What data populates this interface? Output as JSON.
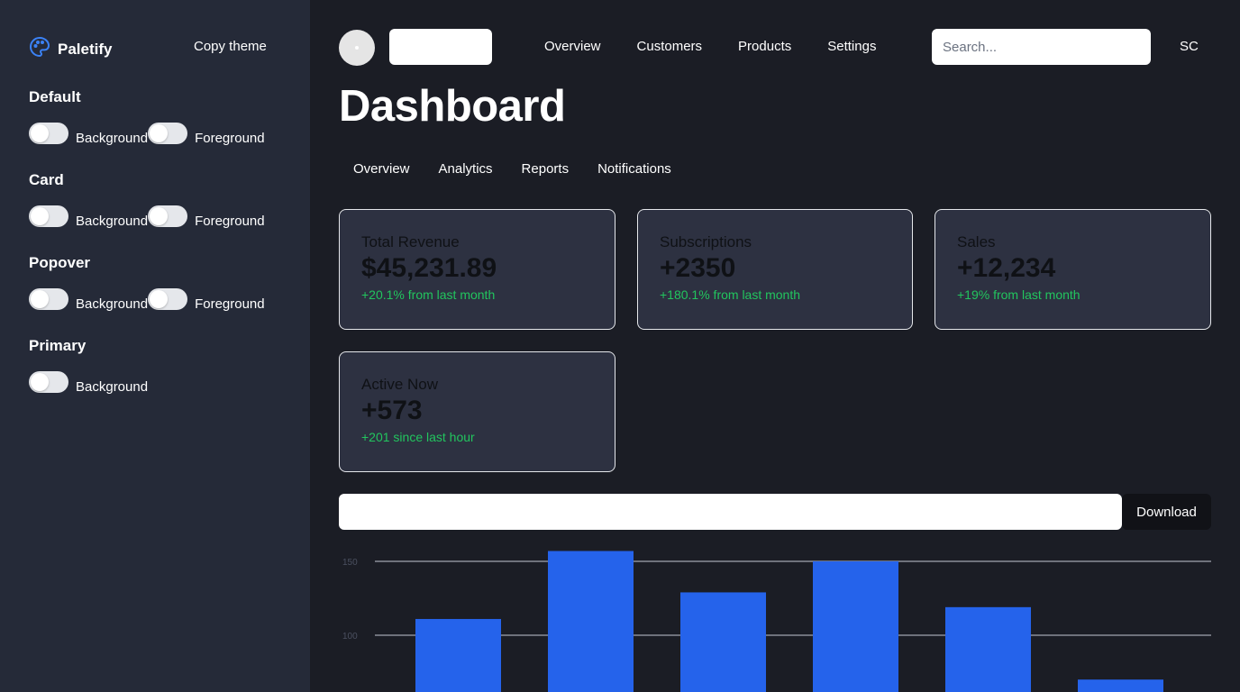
{
  "sidebar": {
    "brand": "Paletify",
    "copy_theme": "Copy theme",
    "sections": [
      {
        "title": "Default",
        "toggles": [
          {
            "label": "Background"
          },
          {
            "label": "Foreground"
          }
        ]
      },
      {
        "title": "Card",
        "toggles": [
          {
            "label": "Background"
          },
          {
            "label": "Foreground"
          }
        ]
      },
      {
        "title": "Popover",
        "toggles": [
          {
            "label": "Background"
          },
          {
            "label": "Foreground"
          }
        ]
      },
      {
        "title": "Primary",
        "toggles": [
          {
            "label": "Background"
          }
        ]
      }
    ]
  },
  "topnav": {
    "links": [
      "Overview",
      "Customers",
      "Products",
      "Settings"
    ],
    "search_placeholder": "Search...",
    "user_initials": "SC"
  },
  "page": {
    "title": "Dashboard",
    "tabs": [
      "Overview",
      "Analytics",
      "Reports",
      "Notifications"
    ]
  },
  "cards": [
    {
      "title": "Total Revenue",
      "value": "$45,231.89",
      "sub": "+20.1% from last month"
    },
    {
      "title": "Subscriptions",
      "value": "+2350",
      "sub": "+180.1% from last month"
    },
    {
      "title": "Sales",
      "value": "+12,234",
      "sub": "+19% from last month"
    },
    {
      "title": "Active Now",
      "value": "+573",
      "sub": "+201 since last hour"
    }
  ],
  "actions": {
    "download": "Download"
  },
  "colors": {
    "accent": "#2563eb",
    "positive": "#22c55e",
    "sidebar_bg": "#252a38",
    "main_bg": "#1b1d25"
  },
  "chart_data": {
    "type": "bar",
    "ytick_labels": [
      "150",
      "100"
    ],
    "values": [
      111,
      157,
      129,
      150,
      119,
      70
    ],
    "ylim": [
      60,
      160
    ],
    "grid": true,
    "color": "#2563eb"
  }
}
